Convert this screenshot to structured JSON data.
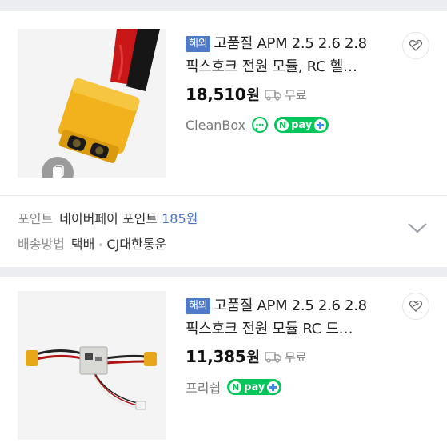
{
  "products": [
    {
      "badge": "해외",
      "title_line1": "고품질 APM 2.5 2.6 2.8",
      "title_line2": "픽스호크 전원 모듈, RC 헬…",
      "price": "18,510",
      "currency": "원",
      "shipping": "무료",
      "seller": "CleanBox",
      "npay": "pay"
    },
    {
      "badge": "해외",
      "title_line1": "고품질 APM 2.5 2.6 2.8",
      "title_line2": "픽스호크 전원 모듈 RC 드…",
      "price": "11,385",
      "currency": "원",
      "shipping": "무료",
      "seller": "프리쉽",
      "npay": "pay"
    }
  ],
  "shipping_info": {
    "point_label": "포인트",
    "point_name": "네이버페이 포인트",
    "point_value": "185원",
    "delivery_label": "배송방법",
    "delivery_type": "택배",
    "delivery_company": "CJ대한통운"
  },
  "colors": {
    "badge": "#4f79c9",
    "npay_green": "#03c75a",
    "point_blue": "#4a72c2"
  }
}
